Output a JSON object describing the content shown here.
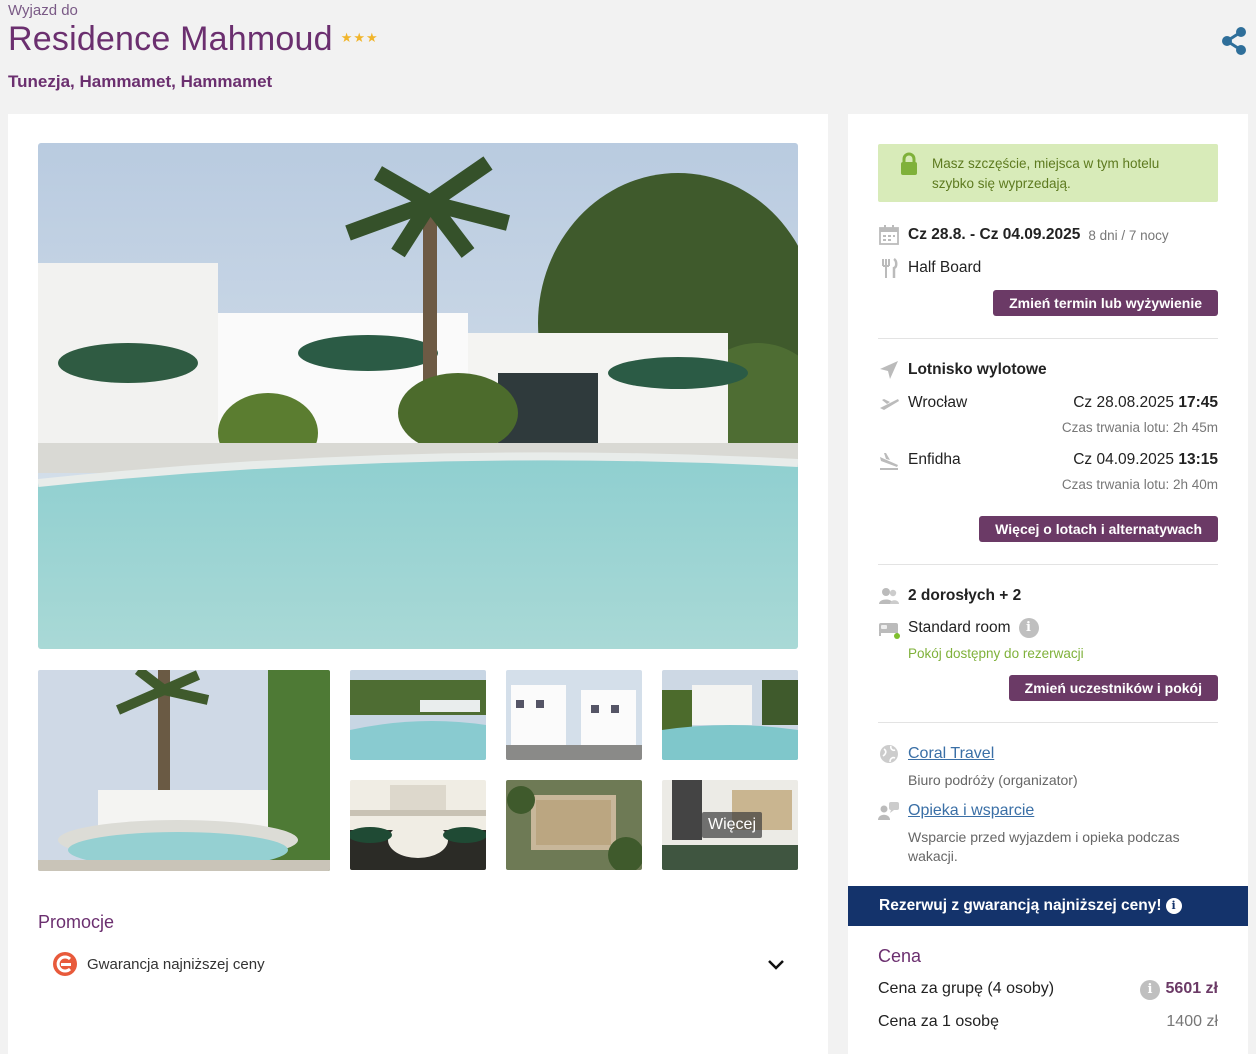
{
  "header": {
    "pre_title": "Wyjazd do",
    "hotel_name": "Residence Mahmoud",
    "stars": "★★★",
    "location": "Tunezja, Hammamet, Hammamet"
  },
  "gallery": {
    "more_label": "Więcej"
  },
  "promotions": {
    "title": "Promocje",
    "items": [
      {
        "label": "Gwarancja najniższej ceny"
      }
    ]
  },
  "sidebar": {
    "alert_text": "Masz szczęście, miejsca w tym hotelu szybko się wyprzedają.",
    "dates": "Cz 28.8. - Cz 04.09.2025",
    "duration": "8 dni / 7 nocy",
    "board": "Half Board",
    "change_term_button": "Zmień termin lub wyżywienie",
    "airport_label": "Lotnisko wylotowe",
    "outbound": {
      "city": "Wrocław",
      "date": "Cz 28.08.2025",
      "time": "17:45",
      "duration": "Czas trwania lotu: 2h 45m"
    },
    "inbound": {
      "city": "Enfidha",
      "date": "Cz 04.09.2025",
      "time": "13:15",
      "duration": "Czas trwania lotu: 2h 40m"
    },
    "flights_button": "Więcej o lotach i alternatywach",
    "participants": "2 dorosłych + 2",
    "room": "Standard room",
    "room_status": "Pokój dostępny do rezerwacji",
    "participants_button": "Zmień uczestników i pokój",
    "organizer_name": "Coral Travel",
    "organizer_desc": "Biuro podróży (organizator)",
    "support_name": "Opieka i wsparcie",
    "support_desc": "Wsparcie przed wyjazdem i opieka podczas wakacji.",
    "banner": "Rezerwuj z gwarancją najniższej ceny!",
    "price_title": "Cena",
    "price_group_label": "Cena za grupę (4 osoby)",
    "price_group_value": "5601 zł",
    "price_person_label": "Cena za 1 osobę",
    "price_person_value": "1400 zł"
  },
  "colors": {
    "brand_purple": "#6b2f6f",
    "button_purple": "#6b3a66",
    "banner_navy": "#14336b",
    "alert_green": "#d8ebb9",
    "star_gold": "#f1b52b",
    "link_blue": "#3a6fa6",
    "share_blue": "#2f6f9a"
  },
  "icons": [
    "share-icon",
    "lock-icon",
    "calendar-icon",
    "cutlery-icon",
    "plane-icon",
    "takeoff-icon",
    "landing-icon",
    "people-icon",
    "bed-icon",
    "info-icon",
    "globe-icon",
    "support-icon",
    "chevron-down-icon"
  ]
}
